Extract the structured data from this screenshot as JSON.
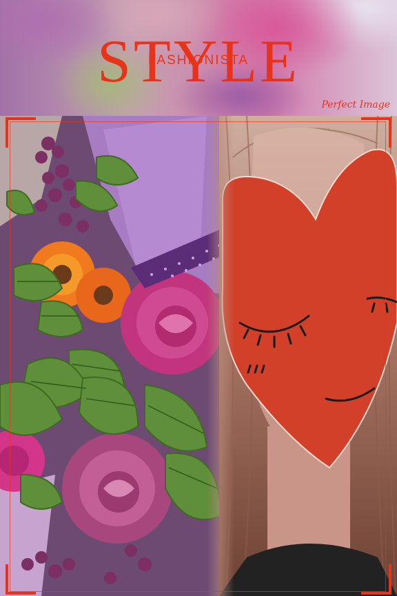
{
  "header": {
    "logo_main": "STYLE",
    "logo_sub": "FASHIONISTA",
    "tagline": "Perfect Image"
  },
  "photo": {
    "left_subject": "bouquet-of-flowers",
    "right_subject": "person-with-paper-heart-mask"
  },
  "colors": {
    "brand": "#e8331b",
    "heart": "#d2402a"
  }
}
